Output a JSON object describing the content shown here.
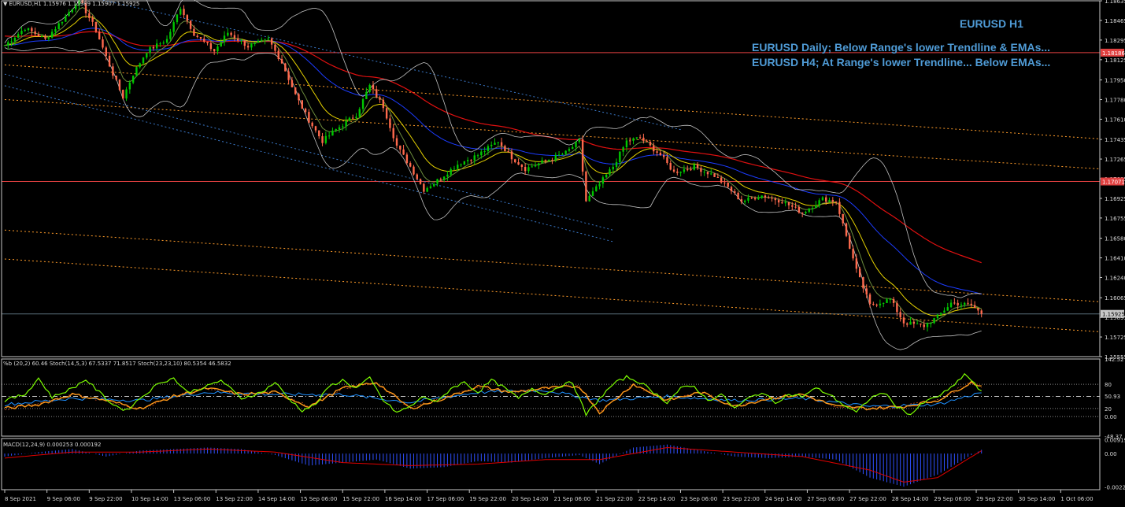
{
  "header": {
    "symbol_line": "EURUSD,H1  1.15976 1.15989 1.15907 1.15925",
    "menu_icon": "triangle-down-icon"
  },
  "annotations": {
    "title": "EURUSD H1",
    "line1": "EURUSD Daily; Below Range's lower Trendline & EMAs...",
    "line2": "EURUSD H4; At Range's lower Trendline... Below EMAs..."
  },
  "colors": {
    "background": "#000000",
    "grid_axis": "#c8c8c8",
    "bull_candle": "#00c800",
    "bear_candle": "#ff6a4d",
    "ema_red": "#e01010",
    "ema_blue": "#1c3cff",
    "ema_yellow": "#e6d200",
    "ema_green": "#6c8c3c",
    "bollinger": "#c0c0c0",
    "trend_orange": "#ff9c2a",
    "channel_blue": "#3a78c8",
    "hline_red": "#e04040",
    "annotation_blue": "#4f9bd6",
    "osc_green": "#7cfc00",
    "osc_orange": "#ff9a1a",
    "osc_blue": "#1e90ff",
    "macd_hist": "#3050ff",
    "macd_signal": "#e00000"
  },
  "chart_data": {
    "type": "candlestick",
    "symbol": "EURUSD",
    "timeframe": "H1",
    "ohlc_last": {
      "open": 1.15976,
      "high": 1.15989,
      "low": 1.15907,
      "close": 1.15925
    },
    "price_axis": {
      "range": [
        1.15555,
        1.18635
      ],
      "ticks": [
        "1.18635",
        "1.18465",
        "1.18295",
        "1.18125",
        "1.17950",
        "1.17780",
        "1.17610",
        "1.17435",
        "1.17265",
        "1.17095",
        "1.16925",
        "1.16755",
        "1.16580",
        "1.16410",
        "1.16240",
        "1.16065",
        "1.15895",
        "1.15725",
        "1.15555"
      ]
    },
    "price_labels": [
      {
        "value": 1.18186,
        "label": "1.18186",
        "kind": "horizontal-line"
      },
      {
        "value": 1.17071,
        "label": "1.17071",
        "kind": "horizontal-line"
      },
      {
        "value": 1.15925,
        "label": "1.15925",
        "kind": "current-price"
      }
    ],
    "time_axis": [
      "8 Sep 2021",
      "9 Sep 06:00",
      "9 Sep 22:00",
      "10 Sep 14:00",
      "13 Sep 06:00",
      "13 Sep 22:00",
      "14 Sep 14:00",
      "15 Sep 06:00",
      "15 Sep 22:00",
      "16 Sep 14:00",
      "17 Sep 06:00",
      "19 Sep 22:00",
      "20 Sep 14:00",
      "21 Sep 06:00",
      "21 Sep 22:00",
      "22 Sep 14:00",
      "23 Sep 06:00",
      "23 Sep 22:00",
      "24 Sep 14:00",
      "27 Sep 06:00",
      "27 Sep 22:00",
      "28 Sep 14:00",
      "29 Sep 06:00",
      "29 Sep 22:00",
      "30 Sep 14:00",
      "1 Oct 06:00"
    ],
    "price_path": [
      [
        0,
        1.1825
      ],
      [
        6,
        1.184
      ],
      [
        12,
        1.183
      ],
      [
        18,
        1.185
      ],
      [
        22,
        1.1865
      ],
      [
        27,
        1.1838
      ],
      [
        32,
        1.18
      ],
      [
        35,
        1.178
      ],
      [
        38,
        1.18
      ],
      [
        42,
        1.182
      ],
      [
        48,
        1.183
      ],
      [
        52,
        1.1858
      ],
      [
        56,
        1.1835
      ],
      [
        62,
        1.182
      ],
      [
        66,
        1.1836
      ],
      [
        72,
        1.1824
      ],
      [
        78,
        1.183
      ],
      [
        82,
        1.181
      ],
      [
        86,
        1.1782
      ],
      [
        90,
        1.176
      ],
      [
        94,
        1.1742
      ],
      [
        98,
        1.1752
      ],
      [
        104,
        1.1765
      ],
      [
        108,
        1.179
      ],
      [
        112,
        1.1772
      ],
      [
        116,
        1.1738
      ],
      [
        120,
        1.172
      ],
      [
        124,
        1.17
      ],
      [
        128,
        1.1708
      ],
      [
        134,
        1.1722
      ],
      [
        140,
        1.173
      ],
      [
        146,
        1.1742
      ],
      [
        150,
        1.1728
      ],
      [
        154,
        1.1718
      ],
      [
        160,
        1.1725
      ],
      [
        166,
        1.1732
      ],
      [
        170,
        1.1742
      ],
      [
        172,
        1.169
      ],
      [
        176,
        1.1705
      ],
      [
        180,
        1.172
      ],
      [
        184,
        1.1742
      ],
      [
        188,
        1.1745
      ],
      [
        194,
        1.173
      ],
      [
        198,
        1.1715
      ],
      [
        204,
        1.172
      ],
      [
        210,
        1.1712
      ],
      [
        214,
        1.1702
      ],
      [
        218,
        1.169
      ],
      [
        224,
        1.1695
      ],
      [
        230,
        1.169
      ],
      [
        236,
        1.168
      ],
      [
        242,
        1.1692
      ],
      [
        246,
        1.169
      ],
      [
        248,
        1.167
      ],
      [
        252,
        1.163
      ],
      [
        256,
        1.16
      ],
      [
        262,
        1.1605
      ],
      [
        266,
        1.1585
      ],
      [
        272,
        1.1582
      ],
      [
        276,
        1.159
      ],
      [
        280,
        1.1602
      ],
      [
        286,
        1.16
      ],
      [
        289,
        1.15925
      ]
    ],
    "indicators": {
      "stoch_pane": {
        "label": "%b (20,2) 60.46   Stoch(14,5,3) 67.5337 71.8517   Stoch(23,23,10) 80.5354 46.5832",
        "axis": [
          "142.52",
          "80",
          "50.93",
          "0.00",
          "20",
          "-48.37"
        ],
        "levels": [
          80,
          50,
          20,
          0
        ],
        "range": [
          -48.37,
          142.52
        ],
        "pb_points": [
          [
            0,
            40
          ],
          [
            6,
            55
          ],
          [
            10,
            95
          ],
          [
            14,
            48
          ],
          [
            20,
            70
          ],
          [
            24,
            92
          ],
          [
            28,
            60
          ],
          [
            32,
            30
          ],
          [
            36,
            15
          ],
          [
            40,
            45
          ],
          [
            46,
            85
          ],
          [
            50,
            95
          ],
          [
            54,
            60
          ],
          [
            60,
            75
          ],
          [
            64,
            90
          ],
          [
            70,
            45
          ],
          [
            76,
            60
          ],
          [
            80,
            85
          ],
          [
            84,
            45
          ],
          [
            88,
            15
          ],
          [
            92,
            30
          ],
          [
            96,
            75
          ],
          [
            100,
            90
          ],
          [
            104,
            70
          ],
          [
            108,
            95
          ],
          [
            112,
            40
          ],
          [
            116,
            10
          ],
          [
            120,
            25
          ],
          [
            124,
            50
          ],
          [
            128,
            35
          ],
          [
            132,
            70
          ],
          [
            136,
            85
          ],
          [
            140,
            60
          ],
          [
            144,
            90
          ],
          [
            148,
            70
          ],
          [
            152,
            45
          ],
          [
            156,
            70
          ],
          [
            160,
            55
          ],
          [
            164,
            75
          ],
          [
            168,
            85
          ],
          [
            172,
            5
          ],
          [
            176,
            45
          ],
          [
            180,
            80
          ],
          [
            184,
            98
          ],
          [
            188,
            85
          ],
          [
            192,
            60
          ],
          [
            196,
            35
          ],
          [
            200,
            70
          ],
          [
            204,
            75
          ],
          [
            208,
            40
          ],
          [
            212,
            55
          ],
          [
            216,
            20
          ],
          [
            220,
            45
          ],
          [
            224,
            60
          ],
          [
            228,
            35
          ],
          [
            232,
            55
          ],
          [
            236,
            50
          ],
          [
            240,
            70
          ],
          [
            244,
            55
          ],
          [
            248,
            30
          ],
          [
            252,
            10
          ],
          [
            256,
            45
          ],
          [
            260,
            60
          ],
          [
            264,
            25
          ],
          [
            268,
            5
          ],
          [
            272,
            35
          ],
          [
            276,
            50
          ],
          [
            280,
            70
          ],
          [
            284,
            105
          ],
          [
            286,
            90
          ],
          [
            289,
            60
          ]
        ],
        "slow_points": [
          [
            0,
            20
          ],
          [
            10,
            30
          ],
          [
            20,
            55
          ],
          [
            30,
            40
          ],
          [
            40,
            20
          ],
          [
            50,
            50
          ],
          [
            60,
            70
          ],
          [
            70,
            55
          ],
          [
            80,
            60
          ],
          [
            90,
            25
          ],
          [
            100,
            70
          ],
          [
            110,
            85
          ],
          [
            120,
            20
          ],
          [
            130,
            45
          ],
          [
            140,
            75
          ],
          [
            150,
            60
          ],
          [
            160,
            70
          ],
          [
            170,
            75
          ],
          [
            176,
            10
          ],
          [
            186,
            80
          ],
          [
            196,
            40
          ],
          [
            206,
            60
          ],
          [
            216,
            25
          ],
          [
            226,
            45
          ],
          [
            236,
            55
          ],
          [
            246,
            25
          ],
          [
            256,
            20
          ],
          [
            266,
            25
          ],
          [
            276,
            40
          ],
          [
            286,
            85
          ],
          [
            289,
            75
          ]
        ],
        "blue_points": [
          [
            0,
            30
          ],
          [
            20,
            45
          ],
          [
            40,
            40
          ],
          [
            60,
            60
          ],
          [
            80,
            55
          ],
          [
            100,
            55
          ],
          [
            120,
            35
          ],
          [
            140,
            60
          ],
          [
            160,
            65
          ],
          [
            176,
            40
          ],
          [
            196,
            50
          ],
          [
            216,
            40
          ],
          [
            236,
            45
          ],
          [
            256,
            25
          ],
          [
            276,
            30
          ],
          [
            289,
            60
          ]
        ]
      },
      "macd_pane": {
        "label": "MACD(12,24,9) 0.000253 0.000192",
        "axis": [
          "0.00919",
          "0.00",
          "-0.002222"
        ],
        "range": [
          -0.0024,
          0.001
        ],
        "hist_points": [
          [
            0,
            -0.0002
          ],
          [
            10,
            0.0001
          ],
          [
            20,
            0.0003
          ],
          [
            30,
            -0.0002
          ],
          [
            40,
            0.0002
          ],
          [
            60,
            0.0004
          ],
          [
            70,
            0.0003
          ],
          [
            80,
            -0.0001
          ],
          [
            90,
            -0.0008
          ],
          [
            100,
            -0.0006
          ],
          [
            110,
            -0.0004
          ],
          [
            120,
            -0.001
          ],
          [
            130,
            -0.0009
          ],
          [
            140,
            -0.0005
          ],
          [
            150,
            -0.0006
          ],
          [
            160,
            -0.0003
          ],
          [
            170,
            -0.0001
          ],
          [
            176,
            -0.0007
          ],
          [
            186,
            0.0004
          ],
          [
            196,
            0.0006
          ],
          [
            206,
            0.0002
          ],
          [
            216,
            -0.0002
          ],
          [
            226,
            -0.0003
          ],
          [
            236,
            -0.0002
          ],
          [
            246,
            -0.0004
          ],
          [
            256,
            -0.0016
          ],
          [
            266,
            -0.0022
          ],
          [
            276,
            -0.0014
          ],
          [
            286,
            -0.0001
          ],
          [
            289,
            0.00025
          ]
        ],
        "signal_points": [
          [
            0,
            -0.0003
          ],
          [
            20,
            0.0001
          ],
          [
            40,
            0.0001
          ],
          [
            60,
            0.0003
          ],
          [
            80,
            0.0001
          ],
          [
            100,
            -0.0006
          ],
          [
            120,
            -0.0008
          ],
          [
            140,
            -0.0007
          ],
          [
            160,
            -0.0004
          ],
          [
            176,
            -0.0004
          ],
          [
            196,
            0.0004
          ],
          [
            216,
            0.0001
          ],
          [
            236,
            -0.0002
          ],
          [
            256,
            -0.0011
          ],
          [
            266,
            -0.0019
          ],
          [
            276,
            -0.0016
          ],
          [
            289,
            0.00019
          ]
        ]
      }
    }
  }
}
